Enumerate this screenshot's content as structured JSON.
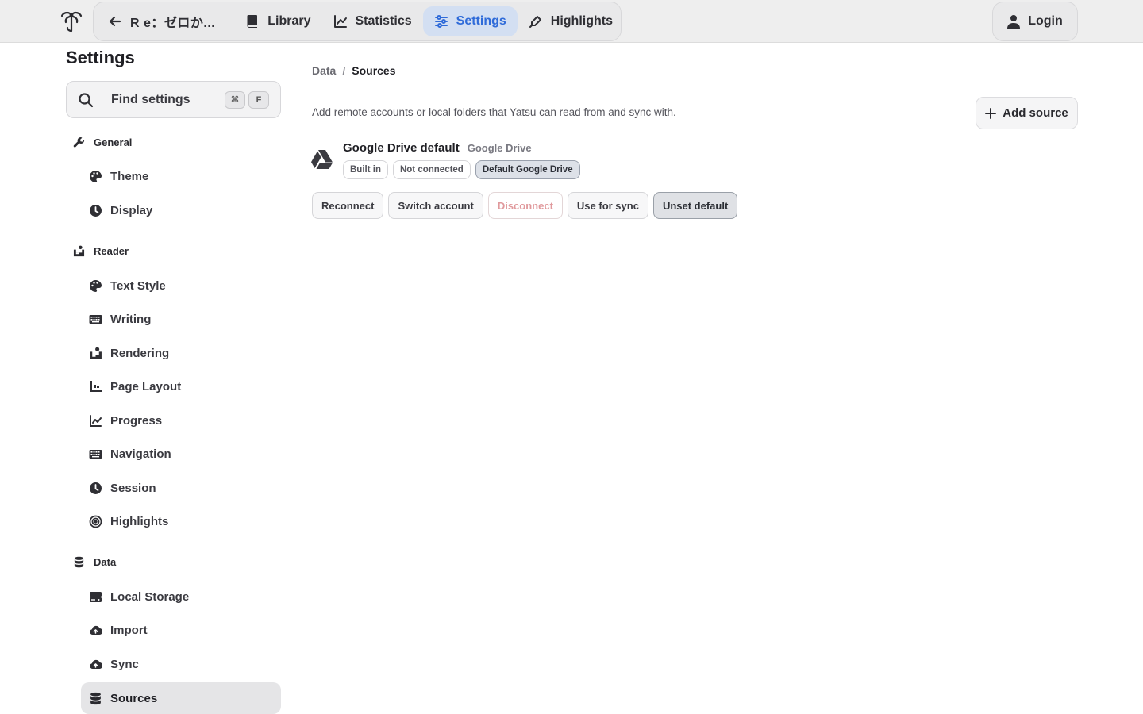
{
  "topbar": {
    "back_title": "R e：ゼロか...",
    "nav": [
      {
        "label": "Library",
        "icon": "book-icon"
      },
      {
        "label": "Statistics",
        "icon": "chart-line-icon"
      },
      {
        "label": "Settings",
        "icon": "sliders-icon",
        "active": true
      },
      {
        "label": "Highlights",
        "icon": "highlighter-icon"
      }
    ],
    "login_label": "Login",
    "active_color": "#2f6bd9"
  },
  "sidebar": {
    "heading": "Settings",
    "search_label": "Find settings",
    "shortcut_keys": [
      "⌘",
      "F"
    ],
    "sections": [
      {
        "label": "General",
        "icon": "wrench-icon",
        "items": [
          {
            "label": "Theme",
            "icon": "palette-icon"
          },
          {
            "label": "Display",
            "icon": "clock-icon"
          }
        ]
      },
      {
        "label": "Reader",
        "icon": "reader-icon",
        "items": [
          {
            "label": "Text Style",
            "icon": "palette-icon"
          },
          {
            "label": "Writing",
            "icon": "keyboard-icon"
          },
          {
            "label": "Rendering",
            "icon": "reader-icon"
          },
          {
            "label": "Page Layout",
            "icon": "layout-icon"
          },
          {
            "label": "Progress",
            "icon": "chart-line-icon"
          },
          {
            "label": "Navigation",
            "icon": "keyboard-icon"
          },
          {
            "label": "Session",
            "icon": "clock-icon"
          },
          {
            "label": "Highlights",
            "icon": "target-icon"
          }
        ]
      },
      {
        "label": "Data",
        "icon": "database-icon",
        "items": [
          {
            "label": "Local Storage",
            "icon": "hard-drive-icon"
          },
          {
            "label": "Import",
            "icon": "cloud-upload-icon"
          },
          {
            "label": "Sync",
            "icon": "cloud-upload-icon"
          },
          {
            "label": "Sources",
            "icon": "database-icon",
            "active": true
          }
        ]
      }
    ]
  },
  "main": {
    "breadcrumb": [
      "Data",
      "Sources"
    ],
    "breadcrumb_sep": "/",
    "description": "Add remote accounts or local folders that Yatsu can read from and sync with.",
    "add_source_label": "Add source",
    "source": {
      "name": "Google Drive default",
      "kind": "Google Drive",
      "icon": "google-drive-icon",
      "badges": [
        "Built in",
        "Not connected",
        "Default Google Drive"
      ],
      "actions": [
        "Reconnect",
        "Switch account",
        "Disconnect",
        "Use for sync",
        "Unset default"
      ]
    }
  }
}
